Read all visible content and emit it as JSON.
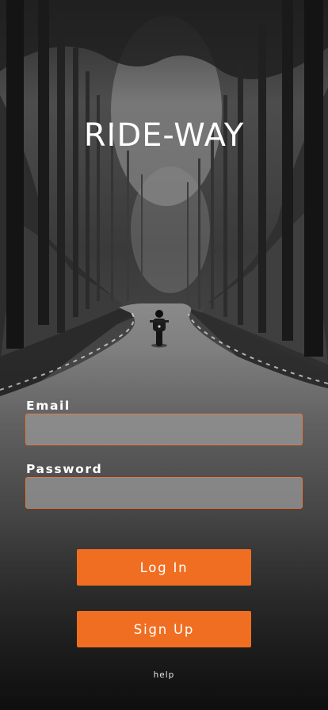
{
  "app": {
    "title": "RIDE-WAY"
  },
  "form": {
    "email_label": "Email",
    "email_value": "",
    "password_label": "Password",
    "password_value": ""
  },
  "actions": {
    "login_label": "Log In",
    "signup_label": "Sign Up",
    "help_label": "help"
  },
  "colors": {
    "accent": "#f06e21",
    "input_border": "#e7763a"
  },
  "background": {
    "subject": "motorcyclist-on-forest-road"
  }
}
